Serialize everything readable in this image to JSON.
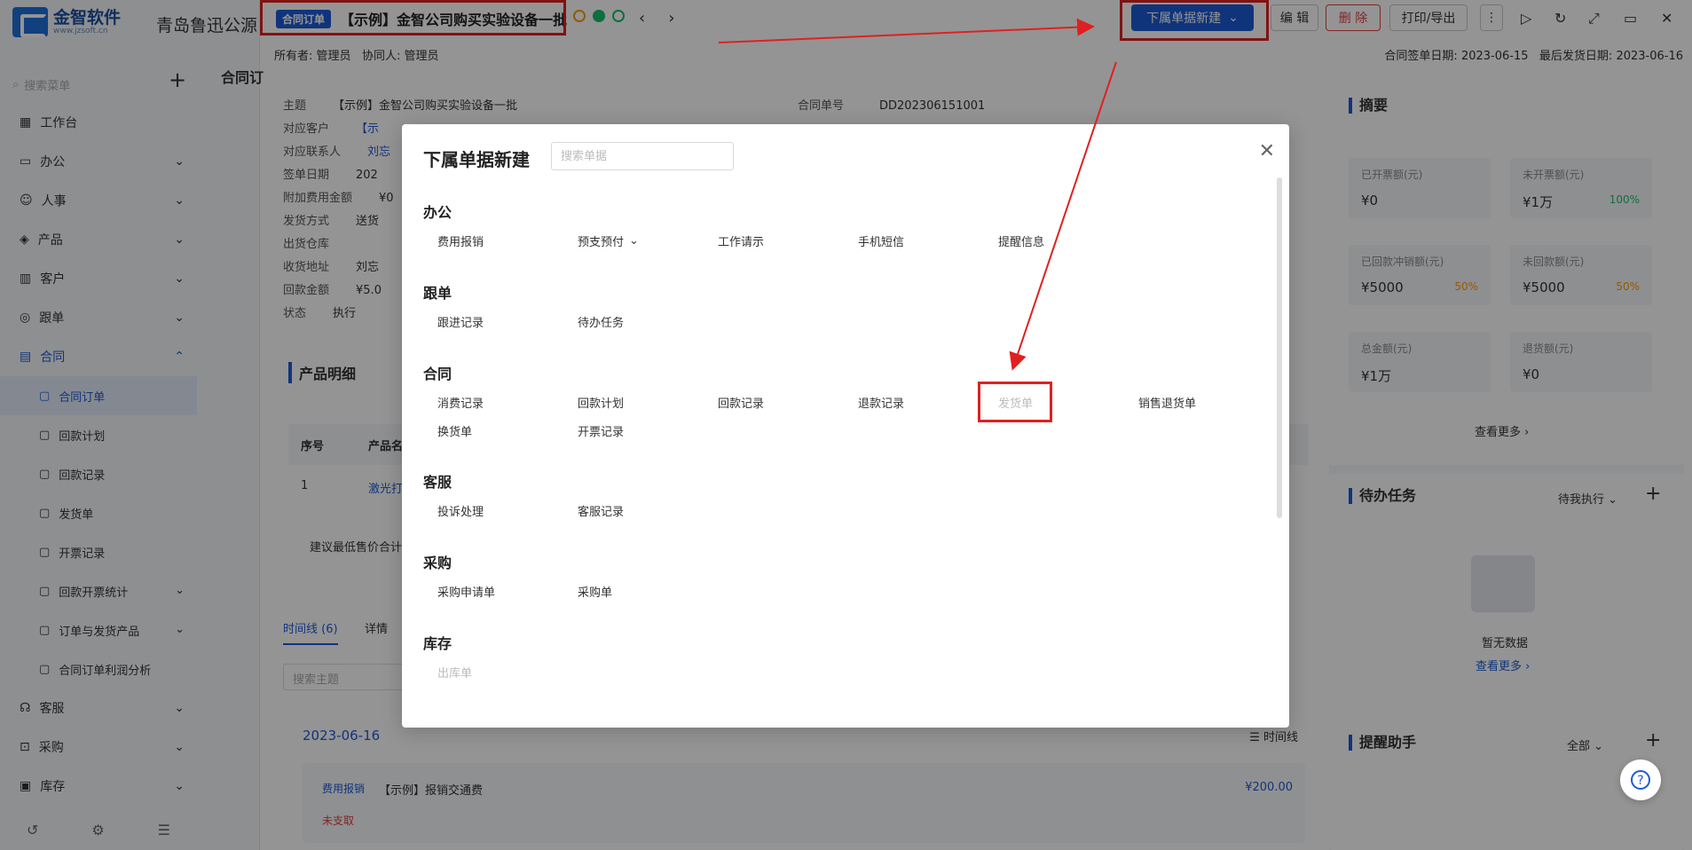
{
  "app": {
    "logo_text": "金智软件",
    "logo_sub": "www.jzsoft.cn",
    "org_name": "青岛鲁迅公源",
    "side_search_placeholder": "搜索菜单"
  },
  "sidebar": {
    "items": [
      {
        "label": "工作台",
        "icon": "workbench-icon"
      },
      {
        "label": "办公",
        "icon": "office-icon"
      },
      {
        "label": "人事",
        "icon": "hr-icon"
      },
      {
        "label": "产品",
        "icon": "product-icon"
      },
      {
        "label": "客户",
        "icon": "customer-icon"
      },
      {
        "label": "跟单",
        "icon": "follow-icon"
      },
      {
        "label": "合同",
        "icon": "contract-icon"
      }
    ],
    "contract_sub": [
      "合同订单",
      "回款计划",
      "回款记录",
      "发货单",
      "开票记录",
      "回款开票统计",
      "订单与发货产品",
      "合同订单利润分析"
    ],
    "after_items": [
      {
        "label": "客服",
        "icon": "service-icon"
      },
      {
        "label": "采购",
        "icon": "purchase-icon"
      },
      {
        "label": "库存",
        "icon": "inventory-icon"
      }
    ]
  },
  "header": {
    "tag": "合同订单",
    "title": "【示例】金智公司购买实验设备一批",
    "new_sub_button": "下属单据新建",
    "edit_button": "编 辑",
    "delete_button": "删 除",
    "print_button": "打印/导出",
    "owner_label": "所有者:",
    "owner": "管理员",
    "collab_label": "协同人:",
    "collab": "管理员",
    "sign_date_label": "合同签单日期:",
    "sign_date": "2023-06-15",
    "ship_date_label": "最后发货日期:",
    "ship_date": "2023-06-16",
    "left_tab": "合同订"
  },
  "detail": {
    "fields": [
      {
        "k": "主题",
        "v": "【示例】金智公司购买实验设备一批"
      },
      {
        "k": "对应客户",
        "v": "【示"
      },
      {
        "k": "对应联系人",
        "v": "刘忘"
      },
      {
        "k": "签单日期",
        "v": "202"
      },
      {
        "k": "附加费用金额",
        "v": "¥0"
      },
      {
        "k": "发货方式",
        "v": "送货"
      },
      {
        "k": "出货仓库",
        "v": ""
      },
      {
        "k": "收货地址",
        "v": "刘忘"
      },
      {
        "k": "回款金额",
        "v": "¥5.0"
      },
      {
        "k": "状态",
        "v": "执行"
      }
    ],
    "order_no_label": "合同单号",
    "order_no": "DD202306151001",
    "product_title": "产品明细",
    "col_no": "序号",
    "col_name": "产品名",
    "row_no": "1",
    "row_name": "激光打",
    "note": "建议最低售价合计",
    "tab_timeline": "时间线 (6)",
    "tab_detail": "详情",
    "search_subject": "搜索主题",
    "tl_date": "2023-06-16",
    "tl_view": "时间线",
    "tl_tag": "费用报销",
    "tl_item": "【示例】报销交通费",
    "tl_amount": "¥200.00",
    "tl_status": "未支取"
  },
  "right": {
    "summary_title": "摘要",
    "stats": [
      {
        "label": "已开票额(元)",
        "value": "¥0",
        "pct": ""
      },
      {
        "label": "未开票额(元)",
        "value": "¥1万",
        "pct": "100%"
      },
      {
        "label": "已回款冲销额(元)",
        "value": "¥5000",
        "pct": "50%"
      },
      {
        "label": "未回款额(元)",
        "value": "¥5000",
        "pct": "50%"
      },
      {
        "label": "总金额(元)",
        "value": "¥1万",
        "pct": ""
      },
      {
        "label": "退货额(元)",
        "value": "¥0",
        "pct": ""
      }
    ],
    "more": "查看更多",
    "todo_title": "待办任务",
    "todo_filter": "待我执行",
    "empty": "暂无数据",
    "more2": "查看更多",
    "remind_title": "提醒助手",
    "remind_filter": "全部"
  },
  "modal": {
    "title": "下属单据新建",
    "search_placeholder": "搜索单据",
    "groups": [
      {
        "title": "办公",
        "items": [
          "费用报销",
          "预支预付",
          "工作请示",
          "手机短信",
          "提醒信息"
        ]
      },
      {
        "title": "跟单",
        "items": [
          "跟进记录",
          "待办任务"
        ]
      },
      {
        "title": "合同",
        "items": [
          "消费记录",
          "回款计划",
          "回款记录",
          "退款记录",
          "发货单",
          "销售退货单",
          "换货单",
          "开票记录"
        ]
      },
      {
        "title": "客服",
        "items": [
          "投诉处理",
          "客服记录"
        ]
      },
      {
        "title": "采购",
        "items": [
          "采购申请单",
          "采购单"
        ]
      },
      {
        "title": "库存",
        "items": [
          "出库单"
        ]
      }
    ]
  },
  "colors": {
    "primary": "#1d5ad6",
    "annotation_red": "#e02020",
    "green": "#19be6b",
    "orange": "#ff9900"
  }
}
